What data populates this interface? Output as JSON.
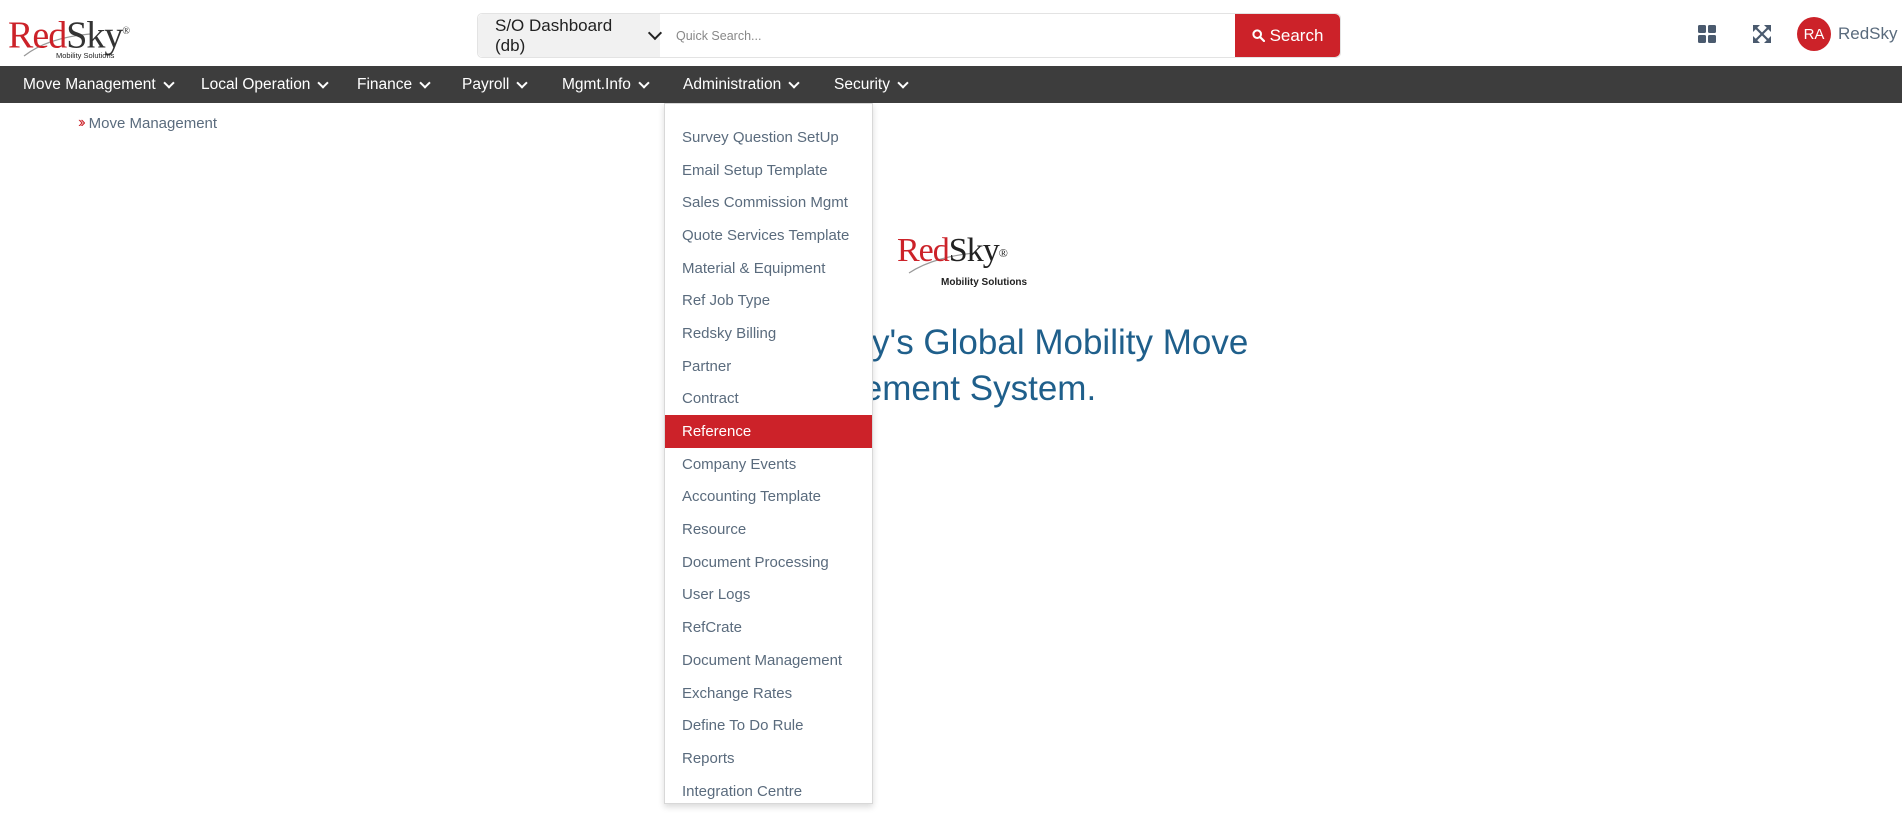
{
  "header": {
    "logo": {
      "brand_red": "Red",
      "brand_dark": "Sky",
      "reg": "®",
      "tagline": "Mobility Solutions"
    },
    "db_select": {
      "value": "S/O Dashboard (db)"
    },
    "search": {
      "placeholder": "Quick Search...",
      "button_label": "Search"
    },
    "icons": {
      "apps": "apps-grid-icon",
      "expand": "expand-icon"
    },
    "user": {
      "initials": "RA",
      "name": "RedSky"
    }
  },
  "nav": {
    "items": [
      {
        "label": "Move Management"
      },
      {
        "label": "Local Operation"
      },
      {
        "label": "Finance"
      },
      {
        "label": "Payroll"
      },
      {
        "label": "Mgmt.Info"
      },
      {
        "label": "Administration"
      },
      {
        "label": "Security"
      }
    ]
  },
  "breadcrumb": {
    "label": "Move Management"
  },
  "center": {
    "logo": {
      "brand_red": "Red",
      "brand_dark": "Sky",
      "reg": "®",
      "tagline": "Mobility Solutions"
    },
    "welcome_line1": "W           dSky's Global Mobility Move",
    "welcome_line2": "agement System."
  },
  "dropdown": {
    "parent": "Administration",
    "items": [
      {
        "label": "Survey Question SetUp"
      },
      {
        "label": "Email Setup Template"
      },
      {
        "label": "Sales Commission Mgmt"
      },
      {
        "label": "Quote Services Template"
      },
      {
        "label": "Material & Equipment"
      },
      {
        "label": "Ref Job Type"
      },
      {
        "label": "Redsky Billing"
      },
      {
        "label": "Partner"
      },
      {
        "label": "Contract"
      },
      {
        "label": "Reference",
        "active": true
      },
      {
        "label": "Company Events"
      },
      {
        "label": "Accounting Template"
      },
      {
        "label": "Resource"
      },
      {
        "label": "Document Processing"
      },
      {
        "label": "User Logs"
      },
      {
        "label": "RefCrate"
      },
      {
        "label": "Document Management"
      },
      {
        "label": "Exchange Rates"
      },
      {
        "label": "Define To Do Rule"
      },
      {
        "label": "Reports"
      },
      {
        "label": "Integration Centre"
      }
    ]
  },
  "colors": {
    "brand_red": "#cc2229",
    "nav_bg": "#3d3d3d",
    "welcome_blue": "#1f5f8b",
    "muted_text": "#5a6b7d"
  }
}
